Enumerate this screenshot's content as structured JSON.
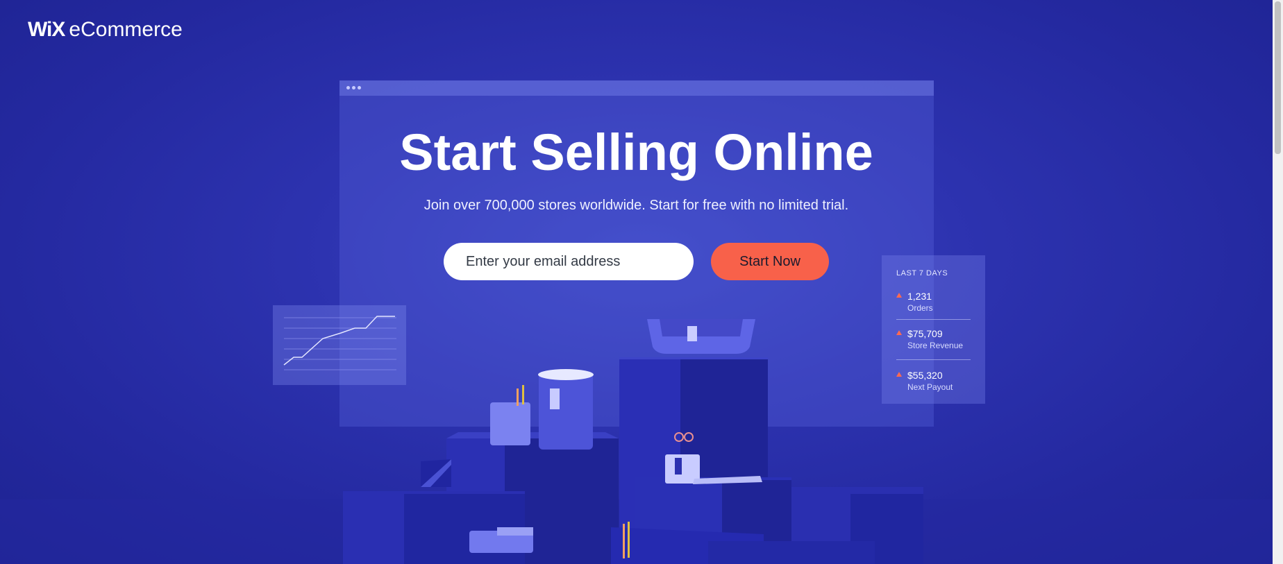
{
  "brand": {
    "wix": "WiX",
    "product": "eCommerce"
  },
  "hero": {
    "title": "Start Selling Online",
    "subtitle": "Join over 700,000 stores worldwide. Start for free with no limited trial."
  },
  "signup": {
    "email_placeholder": "Enter your email address",
    "button_label": "Start Now"
  },
  "stats_card": {
    "title": "LAST 7 DAYS",
    "items": [
      {
        "value": "1,231",
        "label": "Orders",
        "icon": "up-triangle-icon"
      },
      {
        "value": "$75,709",
        "label": "Store Revenue",
        "icon": "up-triangle-icon"
      },
      {
        "value": "$55,320",
        "label": "Next Payout",
        "icon": "up-triangle-icon"
      }
    ]
  },
  "colors": {
    "background": "#2d33b0",
    "accent_button": "#f8614a",
    "trend_arrow": "#ff6a50"
  }
}
